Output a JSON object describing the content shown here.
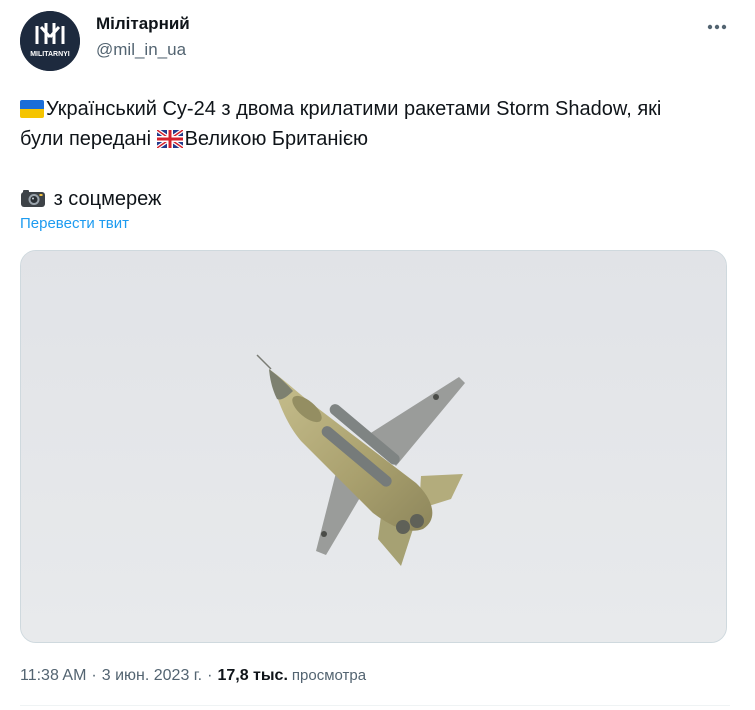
{
  "author": {
    "name": "Мілітарний",
    "handle": "@mil_in_ua",
    "avatar_text": "MILITARNYI"
  },
  "tweet": {
    "line1": "Український Су-24 з двома крилатими ракетами Storm Shadow, які",
    "line2_a": "були передані ",
    "line2_b": "Великою Британією",
    "line3": "з соцмереж",
    "translate_label": "Перевести твит"
  },
  "meta": {
    "time": "11:38 AM",
    "separator": "·",
    "date": "3 июн. 2023 г.",
    "views_count": "17,8 тыс.",
    "views_label": "просмотра"
  },
  "icons": {
    "flag_ua": "flag-ukraine-icon",
    "flag_gb": "flag-uk-icon",
    "camera": "camera-icon",
    "more": "more-icon"
  },
  "colors": {
    "link": "#1d9bf0",
    "secondary_text": "#536471",
    "primary_text": "#0f1419",
    "sky": "#e5e7ea"
  }
}
